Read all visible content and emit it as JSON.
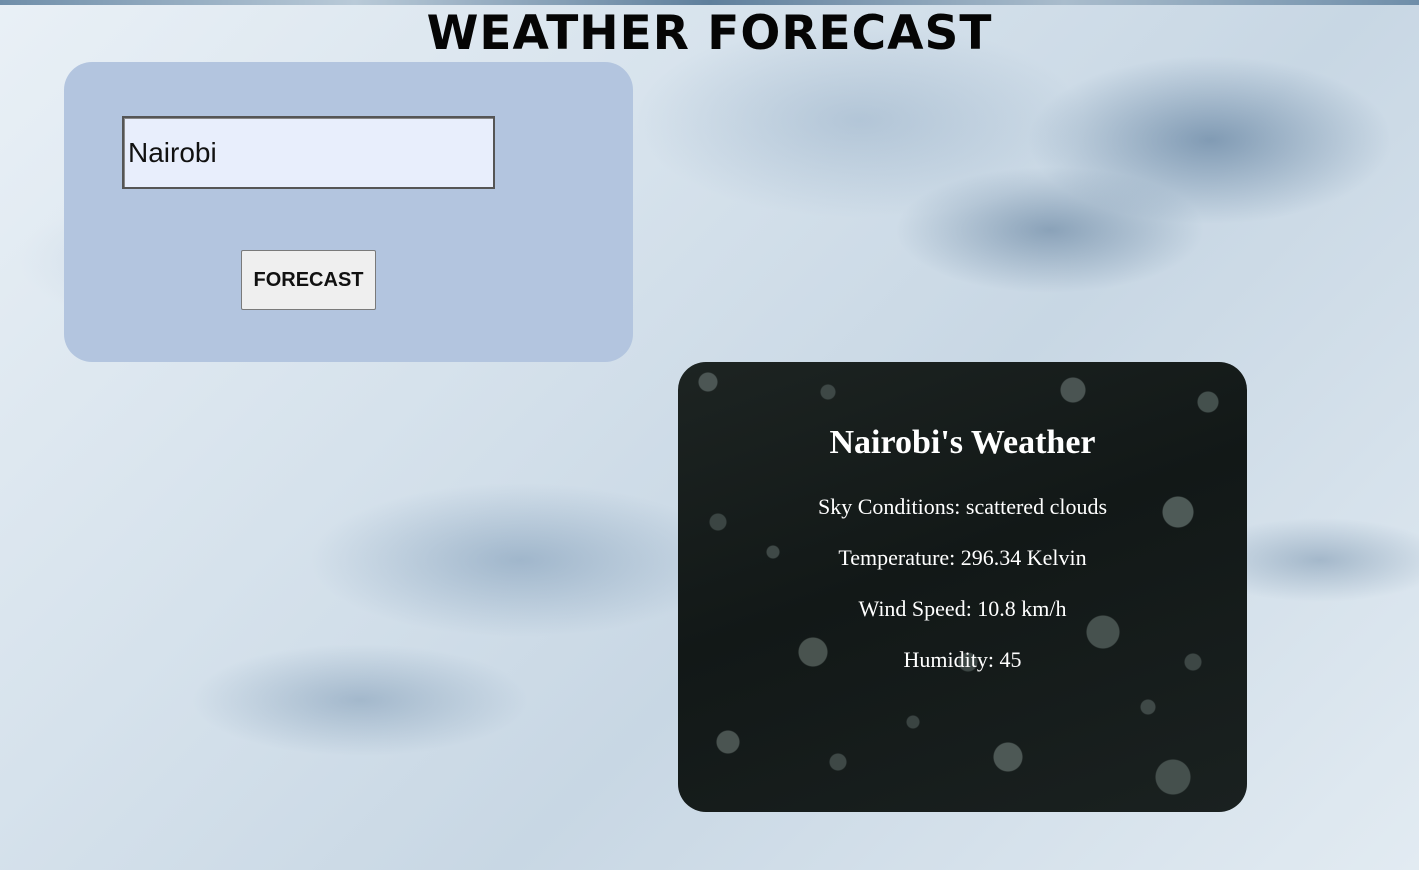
{
  "page": {
    "title": "WEATHER FORECAST"
  },
  "search": {
    "city_value": "Nairobi",
    "button_label": "FORECAST"
  },
  "result": {
    "heading": "Nairobi's Weather",
    "sky": "Sky Conditions: scattered clouds",
    "temperature": "Temperature: 296.34 Kelvin",
    "wind": "Wind Speed: 10.8 km/h",
    "humidity": "Humidity: 45"
  },
  "colors": {
    "panel_background": "#b3c5df",
    "input_background": "#e8eefc",
    "card_background": "#151b1a",
    "card_text": "#ffffff"
  }
}
